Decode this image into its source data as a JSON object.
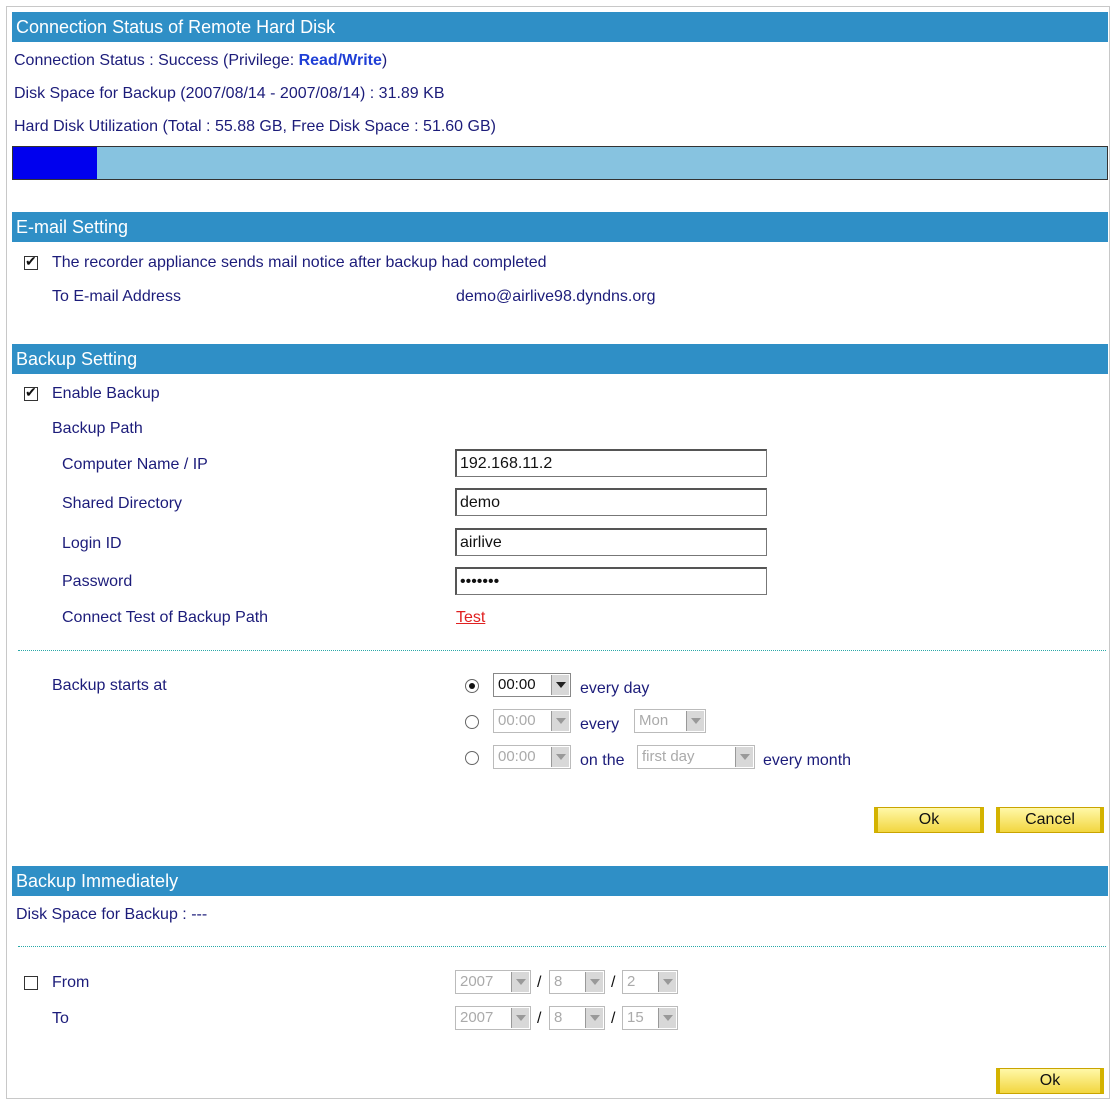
{
  "conn": {
    "header": "Connection Status of Remote Hard Disk",
    "status_prefix": "Connection Status : Success (Privilege: ",
    "privilege": "Read/Write",
    "status_suffix": ")",
    "disk_space": "Disk Space for Backup (2007/08/14 - 2007/08/14) : 31.89 KB",
    "utilization": "Hard Disk Utilization (Total : 55.88 GB, Free Disk Space : 51.60 GB)",
    "used_fraction": 0.077,
    "bar_colors": {
      "used": "#0000ee",
      "free": "#87c3e0"
    }
  },
  "email": {
    "header": "E-mail Setting",
    "notice_checked": true,
    "notice_label": "The recorder appliance sends mail notice after backup had completed",
    "to_label": "To E-mail Address",
    "to_value": "demo@airlive98.dyndns.org"
  },
  "backup": {
    "header": "Backup Setting",
    "enable_checked": true,
    "enable_label": "Enable Backup",
    "path_label": "Backup Path",
    "computer_label": "Computer Name / IP",
    "computer_value": "192.168.11.2",
    "shared_label": "Shared Directory",
    "shared_value": "demo",
    "login_label": "Login ID",
    "login_value": "airlive",
    "password_label": "Password",
    "password_value": "•••••••",
    "test_label": "Connect Test of Backup Path",
    "test_link": "Test",
    "starts_label": "Backup starts at",
    "schedule": {
      "daily_time": "00:00",
      "daily_suffix": "every day",
      "weekly_time": "00:00",
      "weekly_mid": "every",
      "weekly_day": "Mon",
      "monthly_time": "00:00",
      "monthly_mid": "on the",
      "monthly_day": "first day",
      "monthly_suffix": "every month",
      "selected": "daily"
    },
    "ok": "Ok",
    "cancel": "Cancel"
  },
  "immediate": {
    "header": "Backup Immediately",
    "disk_space": "Disk Space for Backup : ---",
    "from_checked": false,
    "from_label": "From",
    "to_label": "To",
    "sep": "/",
    "from": {
      "year": "2007",
      "month": "8",
      "day": "2"
    },
    "to": {
      "year": "2007",
      "month": "8",
      "day": "15"
    },
    "ok": "Ok"
  }
}
